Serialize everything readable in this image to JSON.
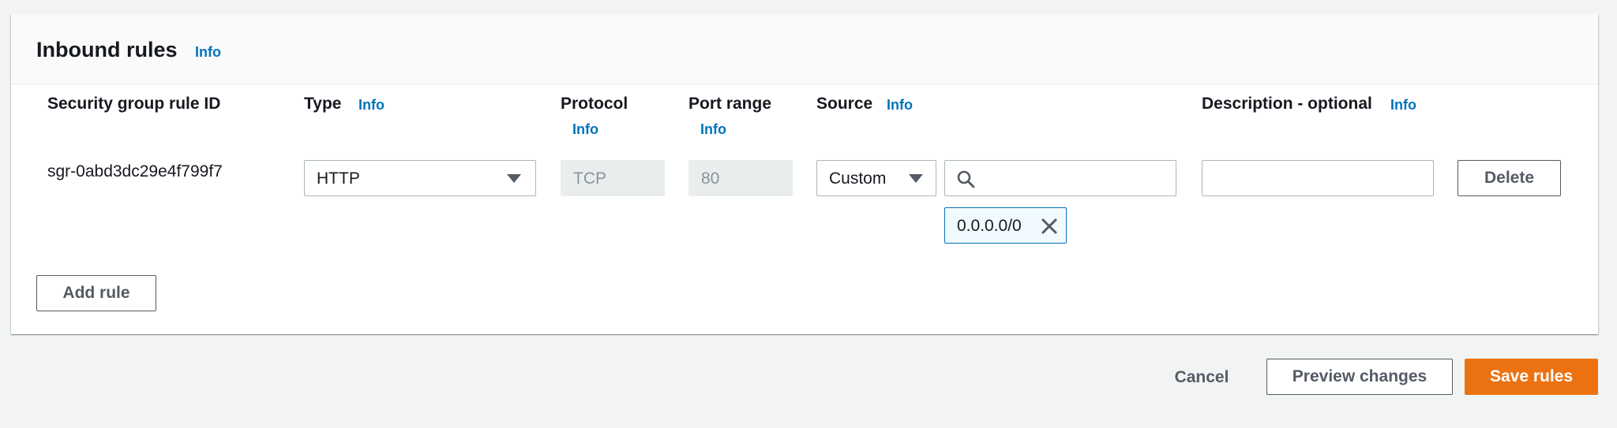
{
  "panel": {
    "title": "Inbound rules",
    "title_info": "Info"
  },
  "columns": {
    "rule_id": "Security group rule ID",
    "type": "Type",
    "type_info": "Info",
    "protocol": "Protocol",
    "protocol_info": "Info",
    "port_range": "Port range",
    "port_range_info": "Info",
    "source": "Source",
    "source_info": "Info",
    "description": "Description - optional",
    "description_info": "Info"
  },
  "rule": {
    "id": "sgr-0abd3dc29e4f799f7",
    "type": "HTTP",
    "protocol": "TCP",
    "port_range": "80",
    "source_type": "Custom",
    "source_search_value": "",
    "source_token": "0.0.0.0/0",
    "description": "",
    "delete_label": "Delete"
  },
  "add_rule_label": "Add rule",
  "footer": {
    "cancel_label": "Cancel",
    "preview_label": "Preview changes",
    "save_label": "Save rules"
  },
  "colors": {
    "accent_link": "#0073bb",
    "primary_button": "#ec7211",
    "background": "#f2f3f3"
  },
  "icons": [
    "caret-down-icon",
    "search-icon",
    "close-icon"
  ]
}
